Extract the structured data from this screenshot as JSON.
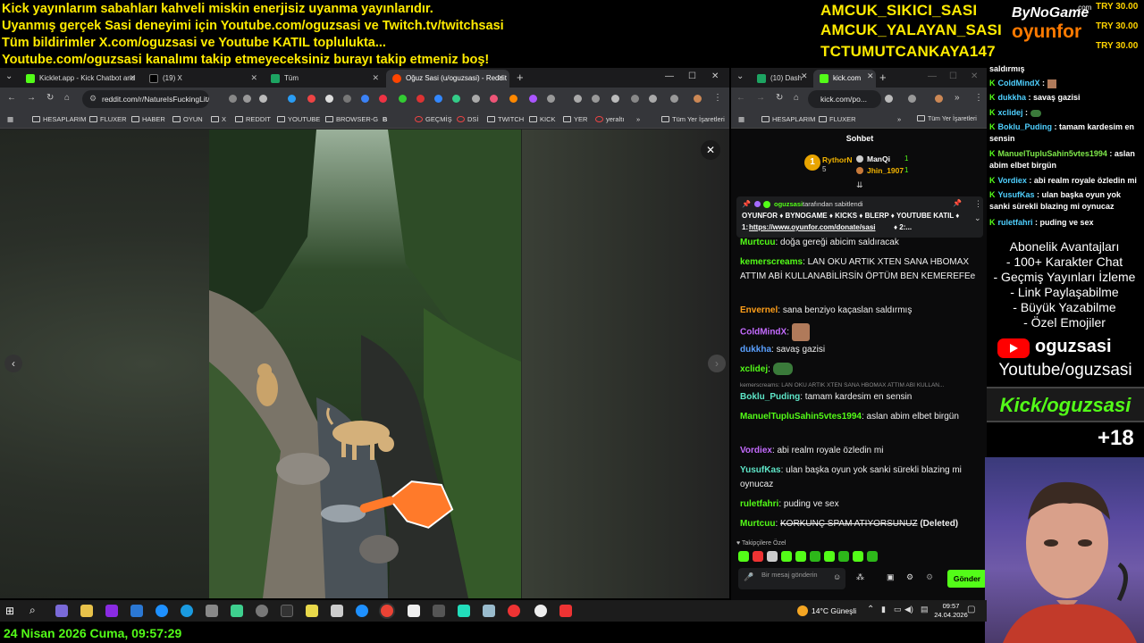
{
  "banner": {
    "line1": "Kick yayınlarım sabahları kahveli miskin enerjisiz uyanma yayınlarıdır.",
    "line2": "Uyanmış gerçek Sasi deneyimi için Youtube.com/oguzsasi ve Twitch.tv/twitchsasi",
    "line3": "Tüm bildirimler X.com/oguzsasi ve Youtube KATIL toplulukta...",
    "line4": "Youtube.com/oguzsasi kanalımı takip etmeyeceksiniz burayı takip etmeniz boş!"
  },
  "overlay_names": [
    "AMCUK_SIKICI_SASI",
    "AMCUK_YALAYAN_SASI",
    "TCTUMUTCANKAYA147"
  ],
  "brand": {
    "top": "ByNoGame",
    "com": ".com",
    "bottom": "oyunfor"
  },
  "donations": [
    "TRY 30.00",
    "TRY 30.00",
    "TRY 30.00"
  ],
  "browser_left": {
    "tabs": [
      "Kicklet.app - Kick Chatbot and",
      "(19) X",
      "Tüm",
      "Oğuz Sasi (u/oguzsasi) - Reddit"
    ],
    "url": "reddit.com/r/NatureIsFuckingLit/...",
    "bookmarks": [
      "HESAPLARIM",
      "FLUXER",
      "HABER",
      "OYUN",
      "X",
      "REDDIT",
      "YOUTUBE",
      "BROWSER-G",
      "B",
      "GEÇMİŞ",
      "DSİ",
      "TWITCH",
      "KICK",
      "YER",
      "yeraltı",
      "Tüm Yer İşaretleri"
    ],
    "close": "✕"
  },
  "browser_right": {
    "tabs": [
      "(10) Dash",
      "kick.com"
    ],
    "url": "kick.com/po...",
    "bookmarks": [
      "HESAPLARIM",
      "FLUXER",
      "Tüm Yer İşaretleri"
    ]
  },
  "chat": {
    "title": "Sohbet",
    "rank1": "RythorN",
    "rank1_count": "5",
    "rank2": "ManQi",
    "rank2_count": "1",
    "rank3": "Jhin_1907",
    "rank3_count": "1",
    "pinned_by": "oguzsasi",
    "pinned_suffix": "tarafından sabitlendi",
    "pinned_text": "OYUNFOR ♦ BYNOGAME ♦ KICKS ♦ BLERP ♦ YOUTUBE KATIL ♦",
    "pinned_link_prefix": "1:",
    "pinned_link": "https://www.oyunfor.com/donate/sasi",
    "pinned_link_suffix": "♦ 2:...",
    "messages": [
      {
        "user": "Murtcuu",
        "color": "#53fc18",
        "text": "doğa gereği abicim saldıracak"
      },
      {
        "user": "kemerscreams",
        "color": "#53fc18",
        "text": "LAN OKU ARTIK XTEN SANA HBOMAX ATTIM ABİ KULLANABİLİRSİN ÖPTÜM BEN KEMEREFEe"
      },
      {
        "user": "Envernel",
        "color": "#ff9f1a",
        "text": "sana benziyo kaçaslan saldırmış"
      },
      {
        "user": "ColdMindX",
        "color": "#c46bff",
        "text": ""
      },
      {
        "user": "dukkha",
        "color": "#5aa0ff",
        "text": "savaş gazisi"
      },
      {
        "user": "xclidej",
        "color": "#53fc18",
        "text": ""
      },
      {
        "user": "Boklu_Puding",
        "color": "#5ee6c8",
        "text": "tamam kardesim en sensin"
      },
      {
        "user": "ManuelTupluSahin5vtes1994",
        "color": "#53fc18",
        "text": "aslan abim elbet birgün"
      },
      {
        "user": "Vordiex",
        "color": "#c46bff",
        "text": "abi realm royale özledin mi"
      },
      {
        "user": "YusufKas",
        "color": "#5ee6c8",
        "text": "ulan başka oyun yok sanki sürekli blazing mi oynucaz"
      },
      {
        "user": "ruletfahri",
        "color": "#53fc18",
        "text": "puding ve sex"
      },
      {
        "user": "Murtcuu",
        "color": "#53fc18",
        "text": "KORKUNÇ SPAM ATIYORSUNUZ",
        "suffix": "(Deleted)"
      }
    ],
    "reply_ref": "kemerscreams: LAN OKU ARTIK XTEN SANA HBOMAX ATTIM ABİ KULLAN...",
    "followers_label": "Takipçilere Özel",
    "input_placeholder": "Bir mesaj gönderin",
    "send": "Gönder"
  },
  "overlay_chat": [
    {
      "user": "",
      "text": "saldırmış"
    },
    {
      "user": "ColdMindX",
      "text": ""
    },
    {
      "user": "dukkha",
      "text": "savaş gazisi"
    },
    {
      "user": "xclidej",
      "text": ""
    },
    {
      "user": "Boklu_Puding",
      "text": "tamam kardesim en sensin"
    },
    {
      "user": "ManuelTupluSahin5vtes1994",
      "text": "aslan abim elbet birgün"
    },
    {
      "user": "Vordiex",
      "text": "abi realm royale özledin mi"
    },
    {
      "user": "YusufKas",
      "text": "ulan başka oyun yok sanki sürekli blazing mi oynucaz"
    },
    {
      "user": "ruletfahri",
      "text": "puding ve sex"
    }
  ],
  "perks": {
    "title": "Abonelik Avantajları",
    "items": [
      "- 100+ Karakter Chat",
      "- Geçmiş Yayınları İzleme",
      "- Link Paylaşabilme",
      "- Büyük Yazabilme",
      "- Özel Emojiler"
    ]
  },
  "social": {
    "youtube_name": "oguzsasi",
    "youtube_url": "Youtube/oguzsasi",
    "kick": "Kick/oguzsasi",
    "age": "+18"
  },
  "taskbar": {
    "weather": "14°C  Güneşli",
    "time": "09:57",
    "date": "24.04.2026"
  },
  "datetime": "24 Nisan 2026 Cuma, 09:57:29",
  "colors": {
    "banner": "#ffeb00",
    "kick_green": "#53fc18",
    "youtube_red": "#ff0000"
  }
}
